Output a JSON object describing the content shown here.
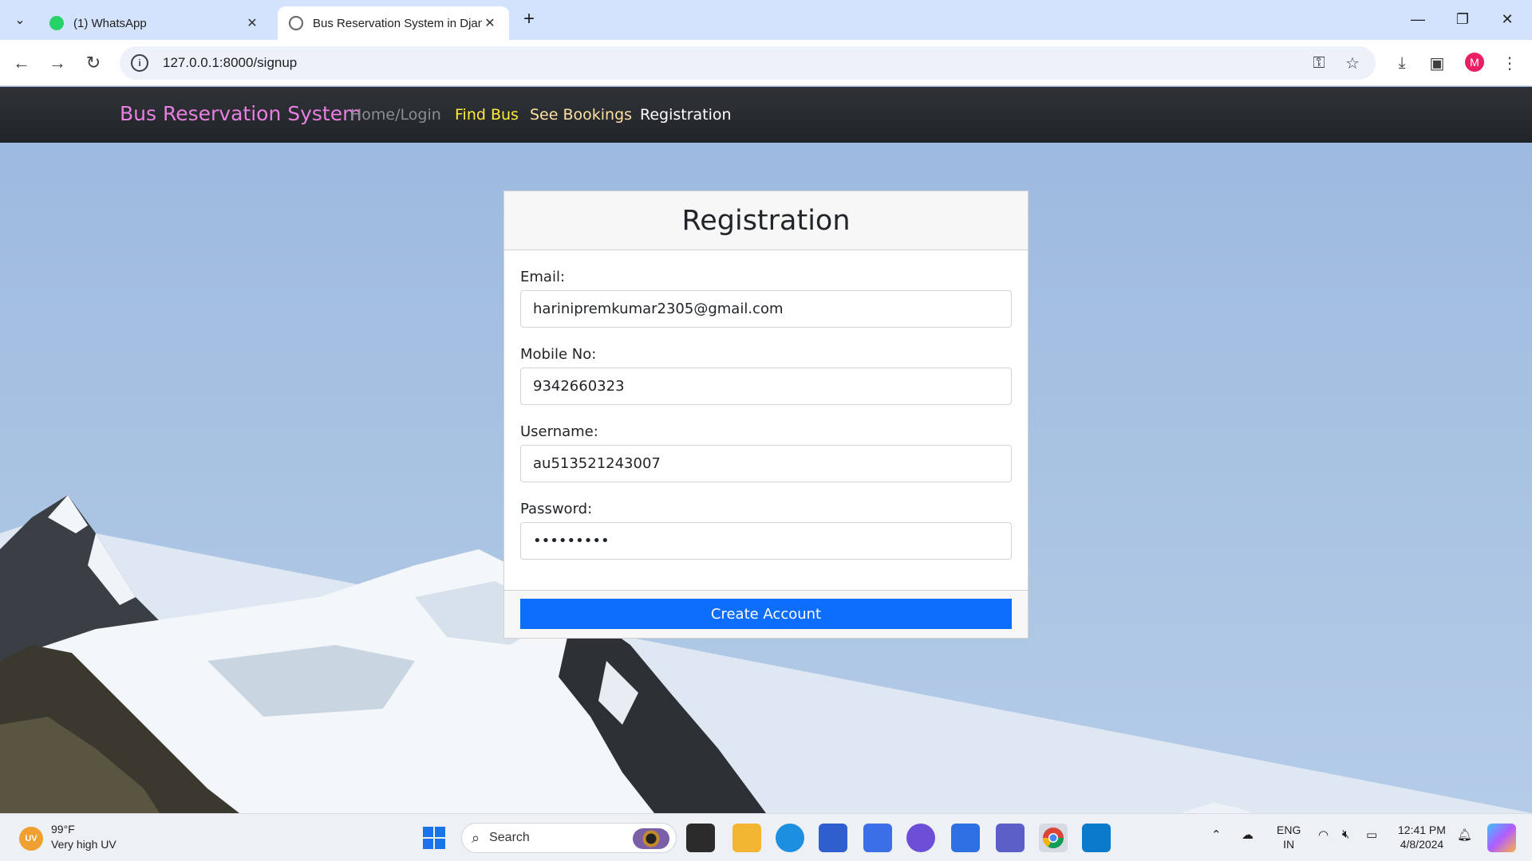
{
  "browser": {
    "tabs": [
      {
        "title": "(1) WhatsApp",
        "active": false
      },
      {
        "title": "Bus Reservation System in Djan",
        "active": true
      }
    ],
    "url": "127.0.0.1:8000/signup",
    "profile_initial": "M"
  },
  "site": {
    "brand": "Bus Reservation System",
    "nav": [
      {
        "label": "Home/Login",
        "color": "#8a8d91"
      },
      {
        "label": "Find Bus",
        "color": "#ffeb3b"
      },
      {
        "label": "See Bookings",
        "color": "#ffe0a3"
      },
      {
        "label": "Registration",
        "color": "#ffffff"
      }
    ]
  },
  "form": {
    "title": "Registration",
    "fields": [
      {
        "label": "Email:",
        "value": "harinipremkumar2305@gmail.com"
      },
      {
        "label": "Mobile No:",
        "value": "9342660323"
      },
      {
        "label": "Username:",
        "value": "au513521243007"
      },
      {
        "label": "Password:",
        "value": "•••••••••"
      }
    ],
    "submit_label": "Create Account"
  },
  "taskbar": {
    "weather_badge": "UV",
    "weather_temp": "99°F",
    "weather_desc": "Very high UV",
    "search_placeholder": "Search",
    "lang_line1": "ENG",
    "lang_line2": "IN",
    "time": "12:41 PM",
    "date": "4/8/2024"
  }
}
